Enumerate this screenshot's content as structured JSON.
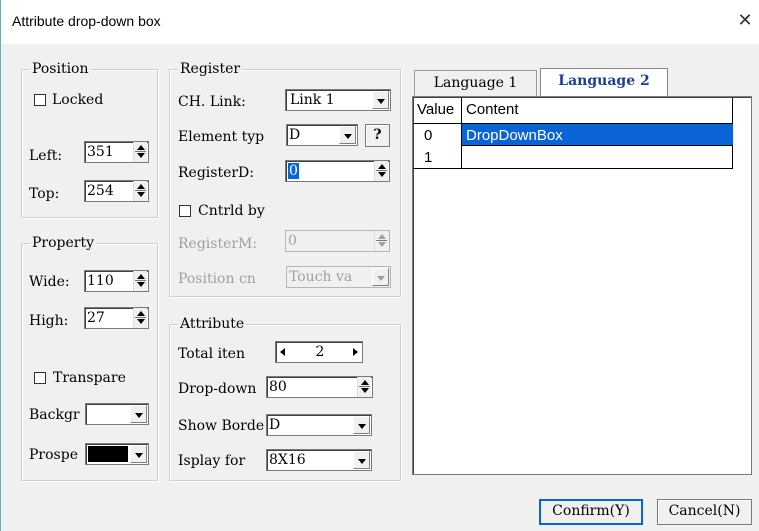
{
  "window": {
    "title": "Attribute drop-down box",
    "close_glyph": "✕"
  },
  "position": {
    "legend": "Position",
    "locked_label": "Locked",
    "left_label": "Left:",
    "left_value": "351",
    "top_label": "Top:",
    "top_value": "254"
  },
  "property": {
    "legend": "Property",
    "wide_label": "Wide:",
    "wide_value": "110",
    "high_label": "High:",
    "high_value": "27",
    "transparent_label": "Transpare",
    "background_label": "Backgr",
    "background_color": "#ffffff",
    "prospect_label": "Prospe",
    "prospect_color": "#000000"
  },
  "register": {
    "legend": "Register",
    "ch_link_label": "CH. Link:",
    "ch_link_value": "Link 1",
    "element_type_label": "Element typ",
    "element_type_value": "D",
    "help_label": "?",
    "register_d_label": "RegisterD:",
    "register_d_value": "0",
    "cntrld_by_label": "Cntrld by",
    "register_m_label": "RegisterM:",
    "register_m_value": "0",
    "position_label": "Position cn",
    "position_value": "Touch va"
  },
  "attribute": {
    "legend": "Attribute",
    "total_items_label": "Total iten",
    "total_items_value": "2",
    "dropdown_label": "Drop-down",
    "dropdown_value": "80",
    "show_border_label": "Show Borde",
    "show_border_value": "D",
    "display_font_label": "Isplay for",
    "display_font_value": "8X16"
  },
  "tabs": [
    {
      "label": "Language 1",
      "active": false
    },
    {
      "label": "Language 2",
      "active": true
    }
  ],
  "table": {
    "headers": [
      "Value",
      "Content"
    ],
    "rows": [
      {
        "value": "0",
        "content": "DropDownBox",
        "selected": true
      },
      {
        "value": "1",
        "content": "",
        "selected": false
      }
    ]
  },
  "buttons": {
    "confirm_label": "Confirm(Y)",
    "cancel_label": "Cancel(N)"
  },
  "colors": {
    "accent": "#0a64d8",
    "title_bg": "#ffffff",
    "dialog_bg": "#f0f0f0"
  }
}
